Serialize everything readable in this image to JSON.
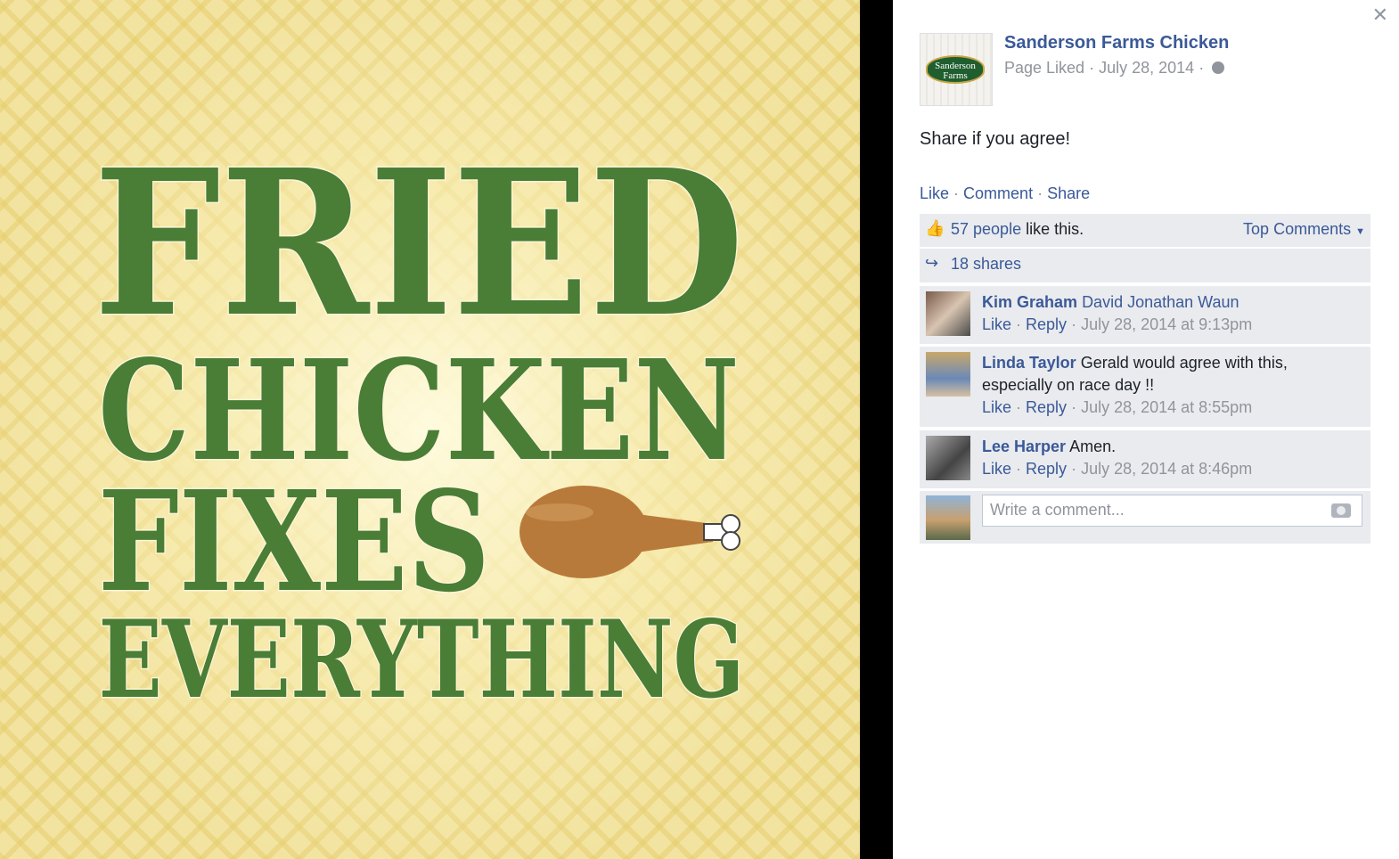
{
  "photo": {
    "lines": [
      "FRIED",
      "CHICKEN",
      "FIXES",
      "EVERYTHING"
    ],
    "text_color": "#4a7d36",
    "shadow_color": "#fdf6d8",
    "drumstick_color": "#b87a3a"
  },
  "post": {
    "page_name": "Sanderson Farms Chicken",
    "logo_text": "Sanderson Farms",
    "page_liked": "Page Liked",
    "date": "July 28, 2014",
    "caption": "Share if you agree!",
    "actions": {
      "like": "Like",
      "comment": "Comment",
      "share": "Share"
    },
    "likes_count": "57 people",
    "likes_suffix": "like this.",
    "top_comments": "Top Comments",
    "shares": "18 shares"
  },
  "comments": [
    {
      "name": "Kim Graham",
      "text": "David Jonathan Waun",
      "like": "Like",
      "reply": "Reply",
      "time": "July 28, 2014 at 9:13pm"
    },
    {
      "name": "Linda Taylor",
      "text": "Gerald would agree with this, especially on race day !!",
      "like": "Like",
      "reply": "Reply",
      "time": "July 28, 2014 at 8:55pm"
    },
    {
      "name": "Lee Harper",
      "text": "Amen.",
      "like": "Like",
      "reply": "Reply",
      "time": "July 28, 2014 at 8:46pm"
    }
  ],
  "composer": {
    "placeholder": "Write a comment..."
  },
  "colors": {
    "link": "#3b5998",
    "muted": "#90949c",
    "panel_bg": "#e9ebee"
  }
}
